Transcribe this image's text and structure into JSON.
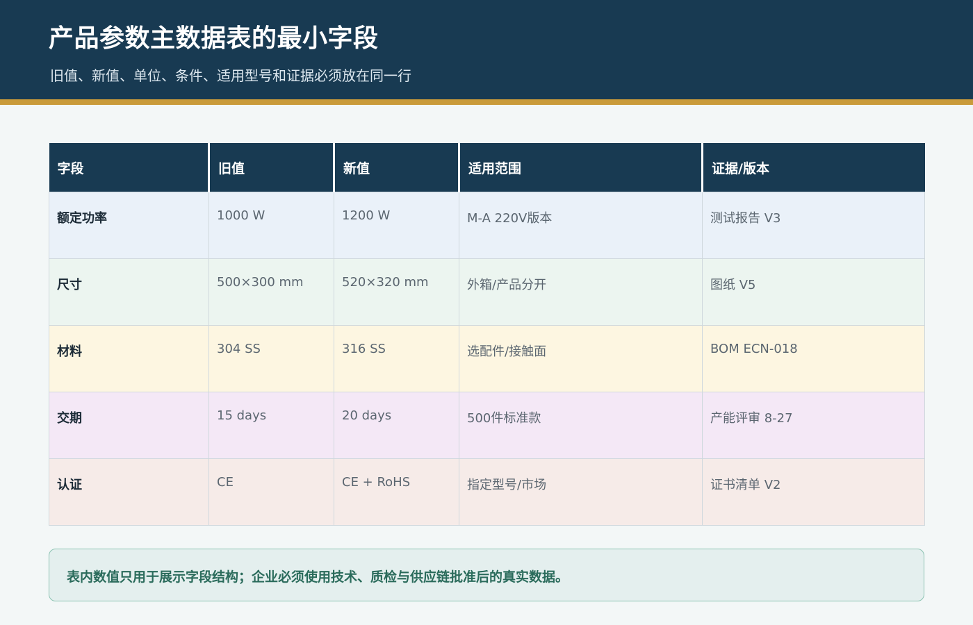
{
  "header": {
    "title": "产品参数主数据表的最小字段",
    "subtitle": "旧值、新值、单位、条件、适用型号和证据必须放在同一行"
  },
  "table": {
    "columns": [
      "字段",
      "旧值",
      "新值",
      "适用范围",
      "证据/版本"
    ],
    "rows": [
      [
        "额定功率",
        "1000 W",
        "1200 W",
        "M-A 220V版本",
        "测试报告 V3"
      ],
      [
        "尺寸",
        "500×300 mm",
        "520×320 mm",
        "外箱/产品分开",
        "图纸 V5"
      ],
      [
        "材料",
        "304 SS",
        "316 SS",
        "选配件/接触面",
        "BOM ECN-018"
      ],
      [
        "交期",
        "15 days",
        "20 days",
        "500件标准款",
        "产能评审 8-27"
      ],
      [
        "认证",
        "CE",
        "CE + RoHS",
        "指定型号/市场",
        "证书清单 V2"
      ]
    ]
  },
  "note": {
    "text": "表内数值只用于展示字段结构；企业必须使用技术、质检与供应链批准后的真实数据。"
  },
  "colors": {
    "header_bg": "#183a52",
    "accent_stripe": "#c99b3a",
    "row_backgrounds": [
      "#eaf1f9",
      "#ecf5f0",
      "#fdf6e1",
      "#f4e8f6",
      "#f6ebe8"
    ],
    "note_text": "#2a6b5b"
  }
}
